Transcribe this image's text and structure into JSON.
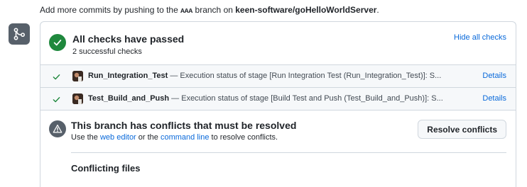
{
  "top_message": {
    "prefix": "Add more commits by pushing to the ",
    "branch": "AAA",
    "middle": " branch on ",
    "repo": "keen-software/goHelloWorldServer",
    "suffix": "."
  },
  "icons": {
    "merge": "git-merge-icon",
    "pass": "check-circle-icon",
    "row_check": "check-icon",
    "alert": "alert-icon"
  },
  "checks": {
    "title": "All checks have passed",
    "subtitle": "2 successful checks",
    "hide_label": "Hide all checks",
    "items": [
      {
        "name": "Run_Integration_Test",
        "description": "— Execution status of stage [Run Integration Test (Run_Integration_Test)]: S...",
        "details_label": "Details"
      },
      {
        "name": "Test_Build_and_Push",
        "description": "— Execution status of stage [Build Test and Push (Test_Build_and_Push)]: S...",
        "details_label": "Details"
      }
    ]
  },
  "conflicts": {
    "title": "This branch has conflicts that must be resolved",
    "sub_prefix": "Use the ",
    "web_editor_label": "web editor",
    "sub_middle": " or the ",
    "command_line_label": "command line",
    "sub_suffix": " to resolve conflicts.",
    "resolve_label": "Resolve conflicts",
    "files_heading": "Conflicting files"
  },
  "colors": {
    "success": "#1f883d",
    "link": "#0969da",
    "muted_icon": "#57606a",
    "border": "#d0d7de"
  }
}
